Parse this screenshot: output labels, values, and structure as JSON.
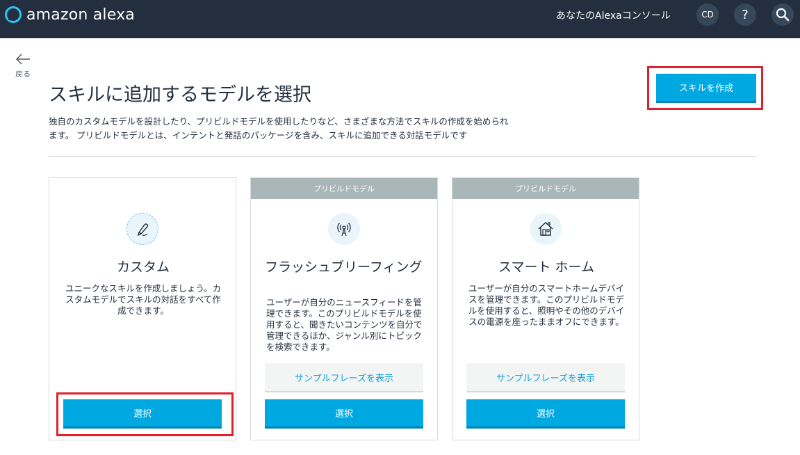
{
  "header": {
    "brand": "amazon alexa",
    "console_link": "あなたのAlexaコンソール",
    "avatar_initials": "CD",
    "help_label": "?"
  },
  "nav": {
    "back_label": "戻る"
  },
  "page": {
    "title": "スキルに追加するモデルを選択",
    "create_button": "スキルを作成",
    "description_line1": "独自のカスタムモデルを設計したり、プリビルドモデルを使用したりなど、さまざまな方法でスキルの作成を始められ",
    "description_line2": "ます。 プリビルドモデルとは、インテントと発話のパッケージを含み、スキルに追加できる対話モデルです"
  },
  "cards": [
    {
      "tag": "",
      "icon": "pen-icon",
      "title": "カスタム",
      "description": "ユニークなスキルを作成しましょう。カスタムモデルでスキルの対話をすべて作成できます。",
      "sample_button": "",
      "select_button": "選択"
    },
    {
      "tag": "プリビルドモデル",
      "icon": "broadcast-antenna-icon",
      "title": "フラッシュブリーフィング",
      "description": "ユーザーが自分のニュースフィードを管理できます。このプリビルドモデルを使用すると、聞きたいコンテンツを自分で管理できるほか、ジャンル別にトピックを検索できます。",
      "sample_button": "サンプルフレーズを表示",
      "select_button": "選択"
    },
    {
      "tag": "プリビルドモデル",
      "icon": "house-icon",
      "title": "スマート ホーム",
      "description": "ユーザーが自分のスマートホームデバイスを管理できます。このプリビルドモデルを使用すると、照明やその他のデバイスの電源を座ったままオフにできます。",
      "sample_button": "サンプルフレーズを表示",
      "select_button": "選択"
    }
  ],
  "colors": {
    "header_bg": "#232f3e",
    "accent": "#00a8e1",
    "highlight": "#e0202a",
    "tag_bg": "#aab7b8"
  }
}
